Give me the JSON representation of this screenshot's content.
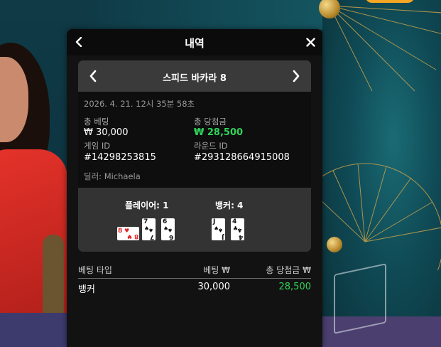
{
  "modal": {
    "title": "내역",
    "back_icon": "chevron-left-icon",
    "close_icon": "close-icon"
  },
  "round": {
    "game_name": "스피드 바카라 8",
    "timestamp": "2026. 4. 21. 12시 35분 58초",
    "total_bet_label": "총 베팅",
    "total_bet_value": "₩ 30,000",
    "total_win_label": "총 당첨금",
    "total_win_value": "₩ 28,500",
    "game_id_label": "게임 ID",
    "game_id_value": "#14298253815",
    "round_id_label": "라운드 ID",
    "round_id_value": "#293128664915008",
    "dealer_line": "딜러: Michaela"
  },
  "hands": {
    "player_label": "플레이어: 1",
    "banker_label": "뱅커: 4",
    "player_cards": [
      {
        "rank": "8",
        "suit": "♥",
        "color": "red",
        "rotated": true
      },
      {
        "rank": "7",
        "suit": "♠",
        "color": "black",
        "rotated": false
      },
      {
        "rank": "6",
        "suit": "♠",
        "color": "black",
        "rotated": false
      }
    ],
    "banker_cards": [
      {
        "rank": "J",
        "suit": "♠",
        "color": "black",
        "rotated": false
      },
      {
        "rank": "4",
        "suit": "♣",
        "color": "black",
        "rotated": false
      }
    ]
  },
  "bets": {
    "headers": [
      "베팅 타입",
      "베팅 ₩",
      "총 당첨금 ₩"
    ],
    "rows": [
      {
        "type": "뱅커",
        "bet": "30,000",
        "win": "28,500"
      }
    ]
  },
  "colors": {
    "accent_green": "#2fd45a",
    "card_red": "#e0262a",
    "modal_bg": "#121212"
  }
}
